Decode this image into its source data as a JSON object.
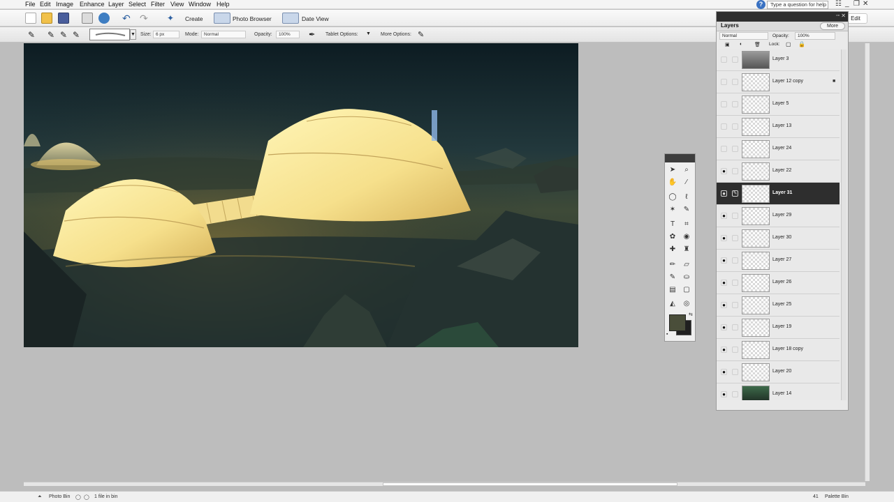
{
  "menu": [
    "File",
    "Edit",
    "Image",
    "Enhance",
    "Layer",
    "Select",
    "Filter",
    "View",
    "Window",
    "Help"
  ],
  "help": {
    "placeholder": "Type a question for help"
  },
  "window_controls": {
    "minimize": "_",
    "restore": "❐",
    "close": "✕"
  },
  "shortcuts": {
    "create": "Create",
    "photo_browser": "Photo Browser",
    "date_view": "Date View",
    "edit": "Edit"
  },
  "options": {
    "size_label": "Size:",
    "size_value": "6 px",
    "mode_label": "Mode:",
    "mode_value": "Normal",
    "opacity_label": "Opacity:",
    "opacity_value": "100%",
    "tablet_label": "Tablet Options:",
    "more_label": "More Options:"
  },
  "layers_panel": {
    "title": "Layers",
    "more": "More",
    "blend_mode": "Normal",
    "opacity_label": "Opacity:",
    "opacity_value": "100%",
    "lock_label": "Lock:",
    "layers": [
      {
        "name": "Layer 3",
        "visible": false,
        "selected": false,
        "locked": false
      },
      {
        "name": "Layer 12 copy",
        "visible": false,
        "selected": false,
        "locked": true
      },
      {
        "name": "Layer 5",
        "visible": false,
        "selected": false,
        "locked": false
      },
      {
        "name": "Layer 13",
        "visible": false,
        "selected": false,
        "locked": false
      },
      {
        "name": "Layer 24",
        "visible": false,
        "selected": false,
        "locked": false
      },
      {
        "name": "Layer 22",
        "visible": true,
        "selected": false,
        "locked": false
      },
      {
        "name": "Layer 31",
        "visible": true,
        "selected": true,
        "locked": false
      },
      {
        "name": "Layer 29",
        "visible": true,
        "selected": false,
        "locked": false
      },
      {
        "name": "Layer 30",
        "visible": true,
        "selected": false,
        "locked": false
      },
      {
        "name": "Layer 27",
        "visible": true,
        "selected": false,
        "locked": false
      },
      {
        "name": "Layer 26",
        "visible": true,
        "selected": false,
        "locked": false
      },
      {
        "name": "Layer 25",
        "visible": true,
        "selected": false,
        "locked": false
      },
      {
        "name": "Layer 19",
        "visible": true,
        "selected": false,
        "locked": false
      },
      {
        "name": "Layer 18 copy",
        "visible": true,
        "selected": false,
        "locked": false
      },
      {
        "name": "Layer 20",
        "visible": true,
        "selected": false,
        "locked": false
      },
      {
        "name": "Layer 14",
        "visible": true,
        "selected": false,
        "locked": false
      }
    ]
  },
  "colors": {
    "foreground": "#4a4e3a",
    "background": "#202020"
  },
  "bottom": {
    "photo_bin": "Photo Bin",
    "files": "1 file in bin",
    "palette_bin": "Palette Bin",
    "count": "41"
  }
}
